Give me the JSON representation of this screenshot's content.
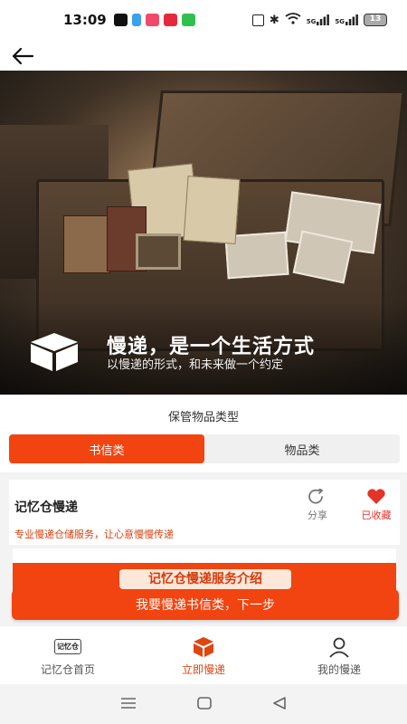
{
  "status_bar": {
    "time": "13:09",
    "network_label": "5G",
    "network_label_2": "5G",
    "battery": "13"
  },
  "hero": {
    "headline": "慢递，是一个生活方式",
    "subline": "以慢递的形式，和未来做一个约定"
  },
  "type_section": {
    "title": "保管物品类型",
    "tabs": [
      {
        "label": "书信类",
        "active": true
      },
      {
        "label": "物品类",
        "active": false
      }
    ]
  },
  "service_card": {
    "name": "记忆仓慢递",
    "description": "专业慢递仓储服务，让心意慢慢传递",
    "share_label": "分享",
    "favorite_label": "已收藏"
  },
  "intro_banner": {
    "label": "记忆仓慢递服务介绍"
  },
  "cta": {
    "label": "我要慢递书信类，下一步"
  },
  "tab_bar": {
    "items": [
      {
        "label": "记忆仓首页",
        "icon": "home-logo-icon",
        "icon_text": "记忆仓",
        "active": false
      },
      {
        "label": "立即慢递",
        "icon": "package-icon",
        "active": true
      },
      {
        "label": "我的慢递",
        "icon": "person-icon",
        "active": false
      }
    ]
  },
  "colors": {
    "accent": "#f24410",
    "favorite": "#e3342a"
  }
}
